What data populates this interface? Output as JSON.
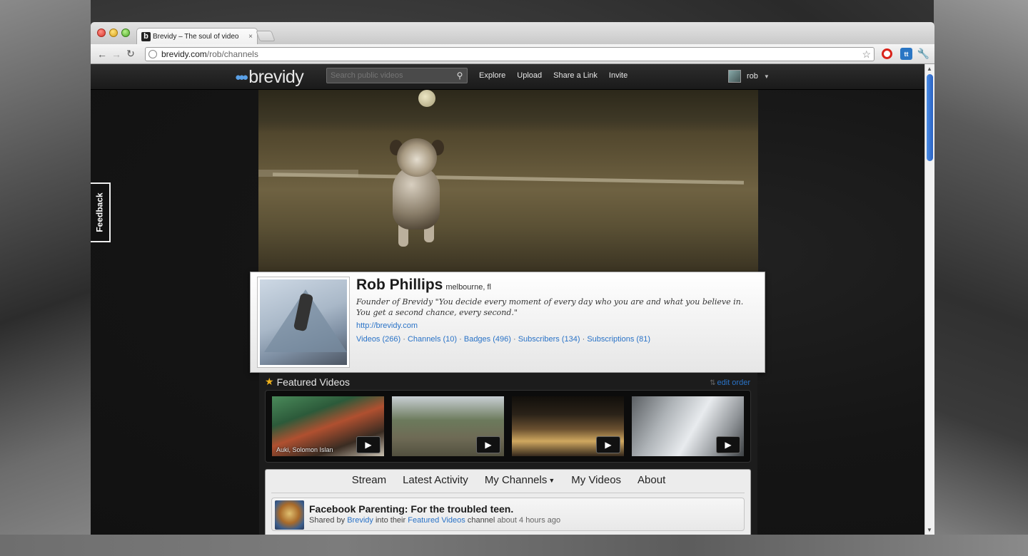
{
  "browser": {
    "tab_title": "Brevidy – The soul of video",
    "tab_close": "×",
    "url_host": "brevidy.com",
    "url_path": "/rob/channels"
  },
  "site": {
    "logo_text": "brevidy",
    "search_placeholder": "Search public videos",
    "nav": [
      "Explore",
      "Upload",
      "Share a Link",
      "Invite"
    ],
    "user_name": "rob",
    "feedback_label": "Feedback"
  },
  "profile": {
    "name": "Rob Phillips",
    "location": "melbourne, fl",
    "bio": "Founder of Brevidy \"You decide every moment of every day who you are and what you believe in. You get a second chance, every second.\"",
    "website": "http://brevidy.com",
    "stats": {
      "videos": "Videos (266)",
      "channels": "Channels (10)",
      "badges": "Badges (496)",
      "subscribers": "Subscribers (134)",
      "subscriptions": "Subscriptions (81)"
    }
  },
  "featured": {
    "title": "Featured Videos",
    "edit_order": "edit order",
    "thumb_caption_1": "Auki, Solomon Islan"
  },
  "channel_tabs": [
    "Stream",
    "Latest Activity",
    "My Channels",
    "My Videos",
    "About"
  ],
  "activity": {
    "title": "Facebook Parenting: For the troubled teen.",
    "meta_prefix": "Shared by",
    "meta_user": "Brevidy",
    "meta_mid": "into their",
    "meta_channel": "Featured Videos",
    "meta_suffix": "channel",
    "meta_time": "about 4 hours ago"
  },
  "colors": {
    "link_blue": "#2a73c7",
    "star_gold": "#f1b31c"
  }
}
